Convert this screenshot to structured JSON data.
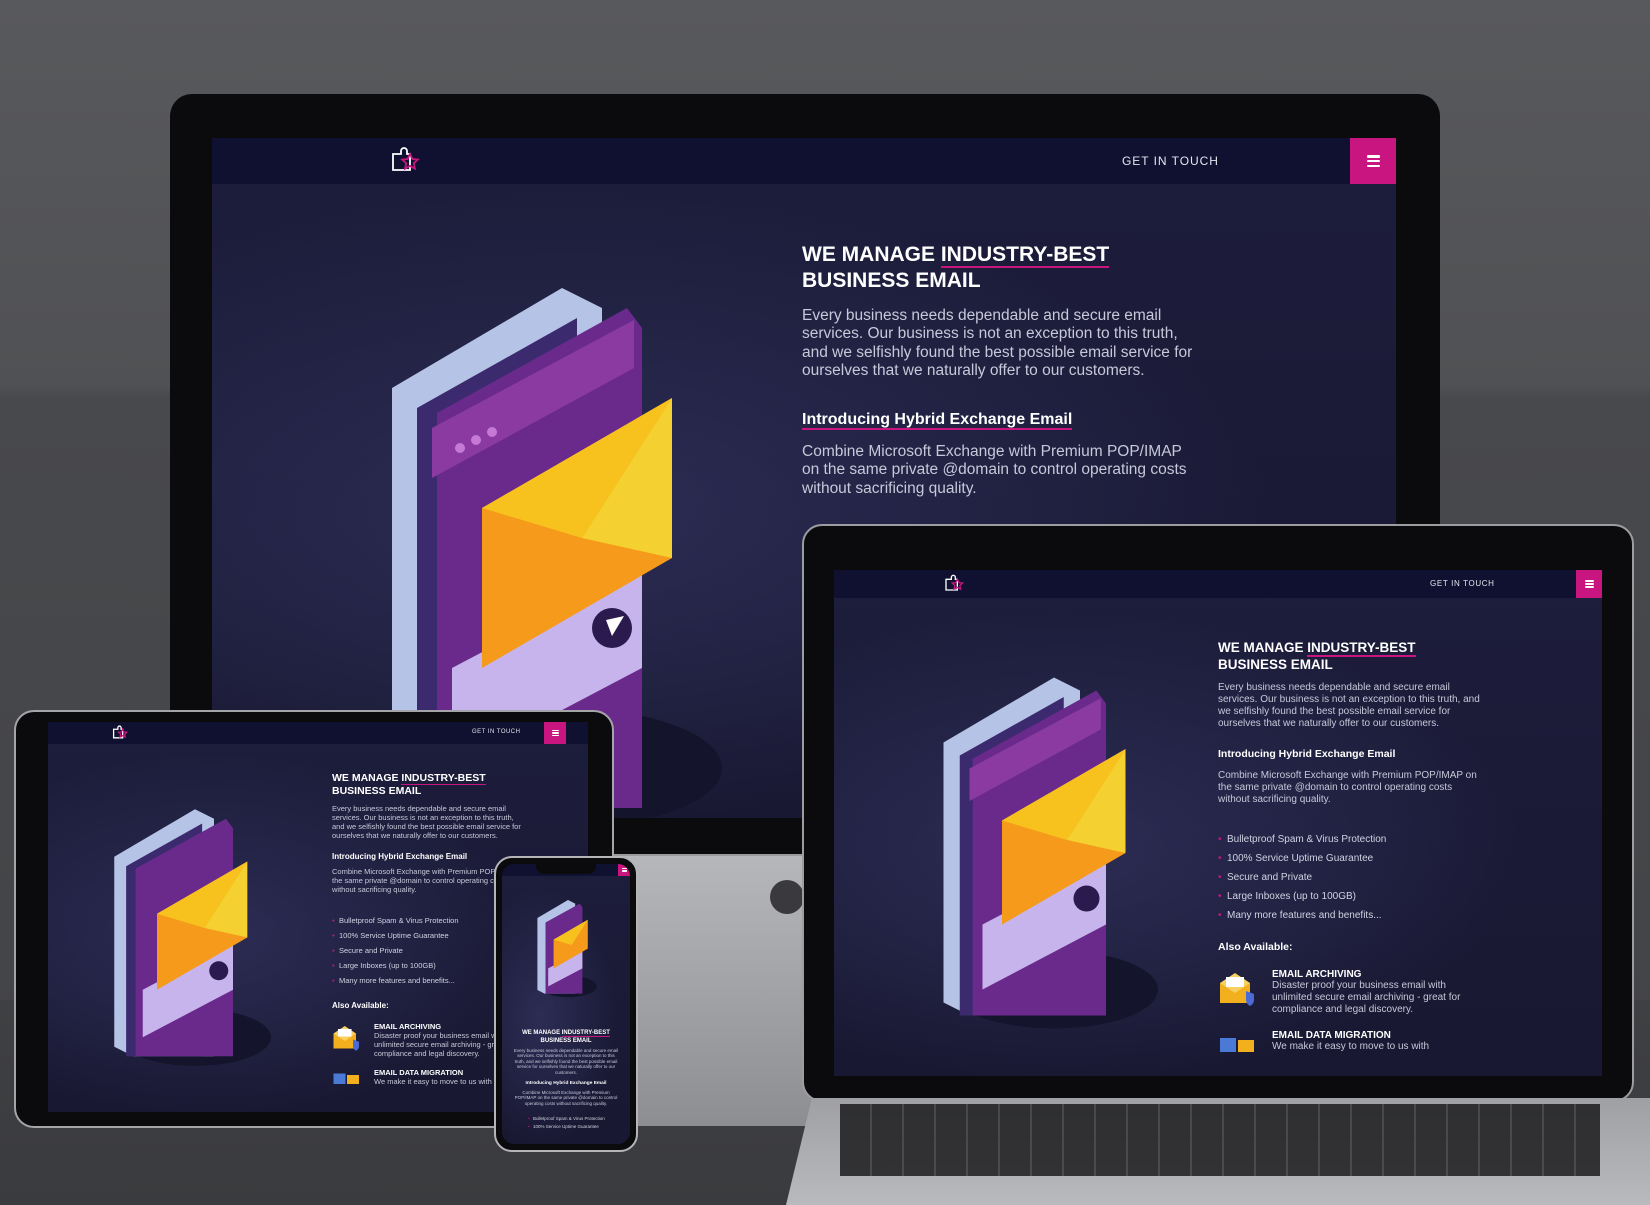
{
  "site": {
    "nav_cta": "GET IN TOUCH",
    "hero_title_part1": "WE MANAGE ",
    "hero_title_highlight": "INDUSTRY-BEST",
    "hero_title_part2": "BUSINESS EMAIL",
    "hero_text": "Every business needs dependable and secure email services. Our business is not an exception to this truth, and we selfishly found the best possible email service for ourselves that we naturally offer to our customers.",
    "sub_heading": "Introducing Hybrid Exchange Email",
    "sub_text": "Combine Microsoft Exchange with Premium POP/IMAP on the same private @domain to control operating costs without sacrificing quality.",
    "features": [
      "Bulletproof Spam & Virus Protection",
      "100% Service Uptime Guarantee",
      "Secure and Private",
      "Large Inboxes (up to 100GB)",
      "Many more features and benefits..."
    ],
    "also_available": "Also Available:",
    "services": [
      {
        "title": "EMAIL ARCHIVING",
        "desc": "Disaster proof your business email with unlimited secure email archiving - great for compliance and legal discovery.",
        "icon": "envelope-shield-icon"
      },
      {
        "title": "EMAIL DATA MIGRATION",
        "desc": "We make it easy to move to us with",
        "icon": "migration-icon"
      }
    ]
  },
  "colors": {
    "accent": "#c8157f",
    "navbar": "#101030",
    "background": "#1a1a38",
    "envelope": "#f2b01e",
    "phone_purple": "#5a2a8a"
  }
}
